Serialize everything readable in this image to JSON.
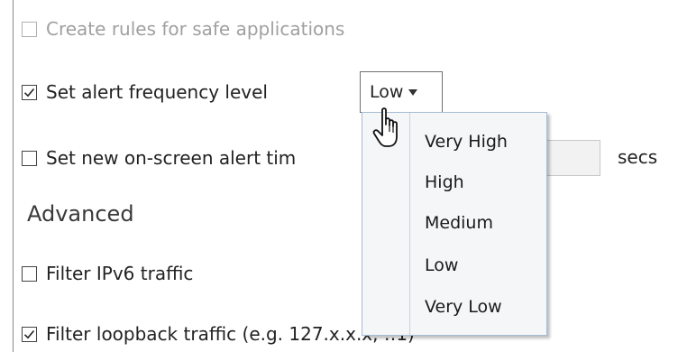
{
  "options": {
    "create_rules": {
      "label": "Create rules for safe applications",
      "checked": false,
      "disabled": true
    },
    "alert_frequency": {
      "label": "Set alert frequency level",
      "checked": true
    },
    "alert_time": {
      "label": "Set new on-screen alert tim",
      "checked": false,
      "unit": "secs",
      "value": ""
    }
  },
  "frequency_select": {
    "value": "Low",
    "options": [
      "Very High",
      "High",
      "Medium",
      "Low",
      "Very Low"
    ]
  },
  "advanced": {
    "heading": "Advanced",
    "filter_ipv6": {
      "label": "Filter IPv6 traffic",
      "checked": false
    },
    "filter_loopback": {
      "label": "Filter loopback traffic (e.g. 127.x.x.x, ::1)",
      "checked": true
    }
  },
  "icons": {
    "checkmark": "checkmark-icon",
    "dropdown_arrow": "triangle-down-icon",
    "cursor": "hand-pointer-icon"
  },
  "colors": {
    "dropdown_bg": "#f4f6f8",
    "dropdown_border": "#a7bdd2",
    "disabled_text": "#a0a0a0"
  }
}
